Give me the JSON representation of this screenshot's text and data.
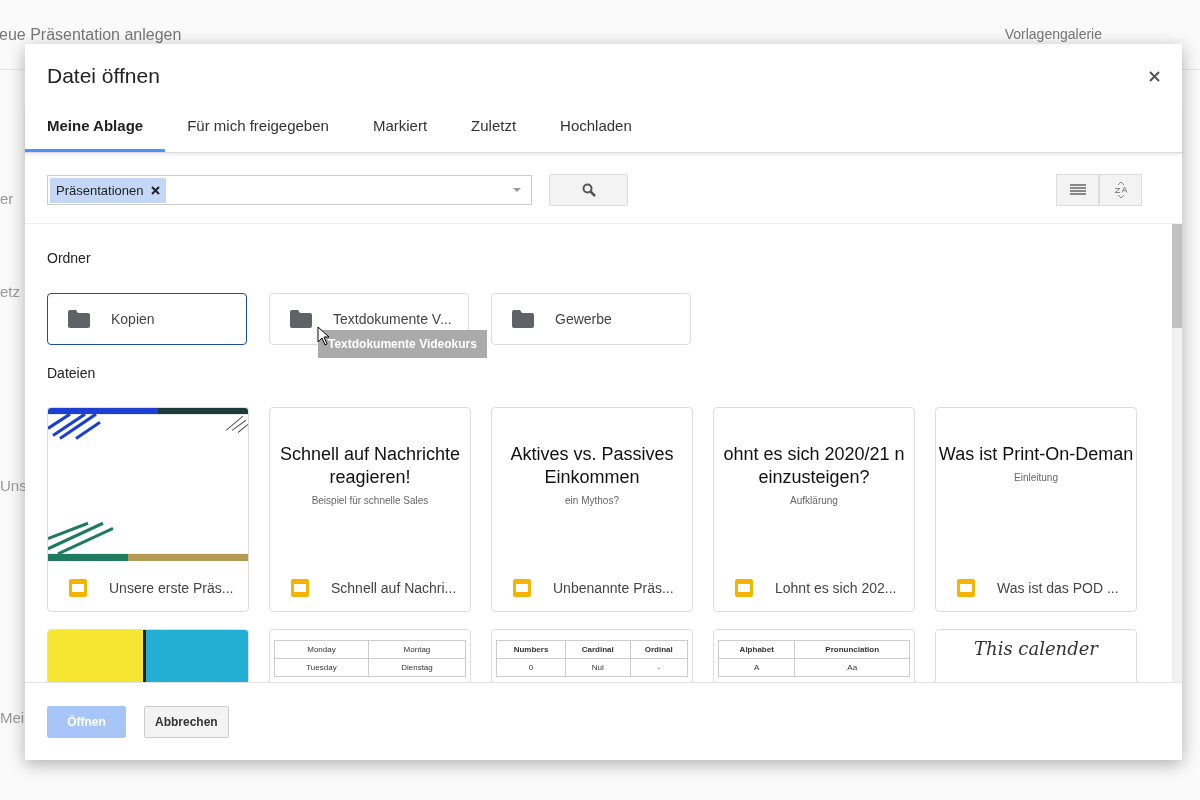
{
  "background": {
    "title": "eue Präsentation anlegen",
    "gallery": "Vorlagengalerie",
    "fragments": [
      "er",
      "etz",
      "Uns",
      "Mei"
    ]
  },
  "dialog": {
    "title": "Datei öffnen",
    "tabs": [
      {
        "label": "Meine Ablage",
        "selected": true
      },
      {
        "label": "Für mich freigegeben",
        "selected": false
      },
      {
        "label": "Markiert",
        "selected": false
      },
      {
        "label": "Zuletzt",
        "selected": false
      },
      {
        "label": "Hochladen",
        "selected": false
      }
    ],
    "filter_chip": "Präsentationen",
    "folders_heading": "Ordner",
    "folders": [
      {
        "name": "Kopien",
        "selected": true
      },
      {
        "name": "Textdokumente V...",
        "selected": false,
        "tooltip": "Textdokumente Videokurs"
      },
      {
        "name": "Gewerbe",
        "selected": false
      }
    ],
    "files_heading": "Dateien",
    "files": [
      {
        "kind": "stripes",
        "name": "Unsere erste Präs..."
      },
      {
        "kind": "title",
        "title_lines": [
          "Schnell auf Nachrichte",
          "reagieren!"
        ],
        "subtitle": "Beispiel für schnelle Sales",
        "name": "Schnell auf Nachri..."
      },
      {
        "kind": "title",
        "title_lines": [
          "Aktives vs. Passives",
          "Einkommen"
        ],
        "subtitle": "ein Mythos?",
        "name": "Unbenannte Präs..."
      },
      {
        "kind": "title",
        "title_lines": [
          "ohnt es sich 2020/21 n",
          "einzusteigen?"
        ],
        "subtitle": "Aufklärung",
        "name": "Lohnt es sich 202..."
      },
      {
        "kind": "title",
        "title_lines": [
          "Was ist Print-On-Deman"
        ],
        "subtitle": "Einleitung",
        "name": "Was ist das POD ..."
      },
      {
        "kind": "blocks"
      },
      {
        "kind": "table",
        "rows": [
          [
            "Monday",
            "Montag"
          ],
          [
            "Tuesday",
            "Dienstag"
          ]
        ]
      },
      {
        "kind": "table",
        "header": [
          "Numbers",
          "Cardinal",
          "Ordinal"
        ],
        "rows": [
          [
            "0",
            "Nul",
            "-"
          ]
        ]
      },
      {
        "kind": "table",
        "header": [
          "Alphabet",
          "Pronunciation"
        ],
        "rows": [
          [
            "A",
            "Aa"
          ]
        ]
      },
      {
        "kind": "script",
        "text": "This calender"
      }
    ],
    "buttons": [
      {
        "label": "Öffnen",
        "disabled": true
      },
      {
        "label": "Abbrechen",
        "disabled": false
      }
    ]
  }
}
